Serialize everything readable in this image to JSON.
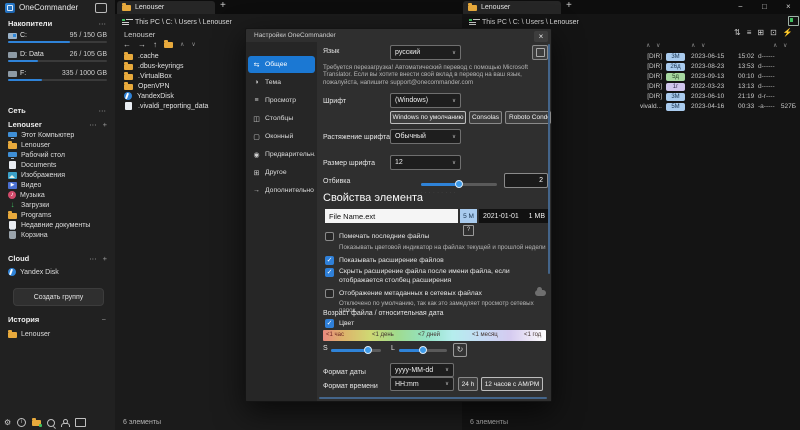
{
  "app": {
    "title": "OneCommander"
  },
  "icons": {
    "ellipsis": "⋯",
    "plus": "+",
    "minus": "−",
    "back": "←",
    "forward": "→",
    "up": "↑",
    "chevron_up": "∧",
    "chevron_down": "∨",
    "chevron_pair": "∧ ∨",
    "close": "×",
    "maximize": "□",
    "minimize": "−",
    "gear": "⚙",
    "music_note": "♪",
    "download_arrow": "↓",
    "reset": "↻",
    "sort": "⇅",
    "list": "≡",
    "grid_plus": "⊞",
    "copy": "⊡",
    "lightning": "⚡",
    "play": "▶",
    "info": "i",
    "check": "✓",
    "tab_general": "⇆",
    "tab_theme": "◑",
    "tab_view": "≡",
    "tab_columns": "◫",
    "tab_window": "▢",
    "tab_preview": "◉",
    "tab_other": "⊞",
    "tab_advanced": "→"
  },
  "colors": {
    "accent_blue": "#1b78d3",
    "slider_blue": "#2f83d8",
    "badge_blue": "#a9cbee",
    "badge_green": "#a6d8a0",
    "badge_lavender": "#cfc5ec",
    "sidebar_bg": "#212121",
    "dialog_bg": "#2f2f2f",
    "gradient_start_red": "#ea8a7f",
    "gradient_end_white": "#ffffff"
  },
  "sidebar": {
    "drives_header": "Накопители",
    "network_header": "Сеть",
    "user_header": "Lenouser",
    "cloud_header": "Cloud",
    "history_header": "История",
    "create_group_label": "Создать группу",
    "drives": [
      {
        "name": "C:",
        "usage": "95 / 150 GB",
        "pct": 63,
        "bar": "width:63%"
      },
      {
        "name": "D:  Data",
        "usage": "26 / 105 GB",
        "pct": 30,
        "bar": "width:30%"
      },
      {
        "name": "F:",
        "usage": "335 / 1000 GB",
        "pct": 34,
        "bar": "width:34%"
      }
    ],
    "user_items": [
      {
        "label": "Этот Компьютер"
      },
      {
        "label": "Lenouser"
      },
      {
        "label": "Рабочий стол"
      },
      {
        "label": "Documents"
      },
      {
        "label": "Изображения"
      },
      {
        "label": "Видео"
      },
      {
        "label": "Музыка"
      },
      {
        "label": "Загрузки"
      },
      {
        "label": "Programs"
      },
      {
        "label": "Недавние документы"
      },
      {
        "label": "Корзина"
      }
    ],
    "cloud_items": [
      {
        "label": "Yandex Disk"
      }
    ],
    "history_items": [
      {
        "label": "Lenouser"
      }
    ]
  },
  "middle": {
    "tab": "Lenouser",
    "breadcrumb": "This PC  \\ C: \\ Users \\ Lenouser",
    "title": "Lenouser",
    "files": [
      ".cache",
      ".dbus-keyrings",
      ".VirtualBox",
      "OpenVPN",
      "YandexDisk",
      ".vivaldi_reporting_data"
    ],
    "status": "6 элементы"
  },
  "right": {
    "tab": "Lenouser",
    "breadcrumb": "This PC  \\ C: \\ Users \\ Lenouser",
    "status": "6 элементы",
    "rows": [
      {
        "name": "[DIR]",
        "age": "3М",
        "date": "2023-06-15",
        "time": "15:02",
        "attrs": "d------",
        "size": ""
      },
      {
        "name": "[DIR]",
        "age": "26д",
        "date": "2023-08-23",
        "time": "13:53",
        "attrs": "d------",
        "size": ""
      },
      {
        "name": "[DIR]",
        "age": "5д",
        "date": "2023-09-13",
        "time": "00:10",
        "attrs": "d------",
        "size": ""
      },
      {
        "name": "[DIR]",
        "age": "1г",
        "date": "2022-03-23",
        "time": "13:13",
        "attrs": "d------",
        "size": ""
      },
      {
        "name": "[DIR]",
        "age": "3М",
        "date": "2023-06-10",
        "time": "21:19",
        "attrs": "d-r----",
        "size": ""
      },
      {
        "name": "vivald...",
        "age": "5М",
        "date": "2023-04-16",
        "time": "00:33",
        "attrs": "-a-----",
        "size": "527Б"
      }
    ]
  },
  "dialog": {
    "title": "Настройки OneCommander",
    "tabs": [
      {
        "label": "Общее",
        "selected": true
      },
      {
        "label": "Тема"
      },
      {
        "label": "Просмотр"
      },
      {
        "label": "Столбцы"
      },
      {
        "label": "Оконный"
      },
      {
        "label": "Предварительн..."
      },
      {
        "label": "Другое"
      },
      {
        "label": "Дополнительно"
      }
    ],
    "language_label": "Язык",
    "language_value": "русский",
    "language_note": "Требуется перезагрузка! Автоматический перевод с помощью Microsoft Translator. Если вы хотите внести свой вклад в перевод на ваш язык, пожалуйста, напишите support@onecommander.com",
    "font_label": "Шрифт",
    "font_value": "(Windows)",
    "font_buttons": [
      "Windows по умолчанию",
      "Consolas",
      "Roboto Condensed"
    ],
    "stretch_label": "Растяжение шрифта",
    "stretch_value": "Обычный",
    "size_label": "Размер шрифта",
    "size_value": "12",
    "spacing_label": "Отбивка",
    "spacing_value": "2",
    "section_title": "Свойства элемента",
    "preview_name": "File Name.ext",
    "preview_age": "5 М",
    "preview_date": "2021-01-01",
    "preview_size": "1 MB",
    "help_badge": "?",
    "checks": [
      {
        "checked": false,
        "label": "Помечать последние файлы",
        "note": "Показывать цветовой индикатор на файлах текущей и прошлой недели"
      },
      {
        "checked": true,
        "label": "Показывать расширение файлов"
      },
      {
        "checked": true,
        "label": "Скрыть расширение файла после имени файла, если отображается столбец расширения"
      },
      {
        "checked": false,
        "label": "Отображение метаданных в сетевых файлах",
        "note": "Отключено по умолчанию, так как это замедляет просмотр сетевых папок"
      }
    ],
    "age_section_label": "Возраст файла / относительная дата",
    "color_label": "Цвет",
    "gradient_labels": [
      "<1 час",
      "<1 день",
      "<7 дней",
      "<1 месяц",
      "<1 год"
    ],
    "s_label": "S",
    "l_label": "L",
    "date_format_label": "Формат даты",
    "date_format_value": "yyyy-MM-dd",
    "time_format_label": "Формат времени",
    "time_format_value": "HH:mm",
    "time_buttons": [
      "24 h",
      "12 часов с AM/PM"
    ]
  }
}
